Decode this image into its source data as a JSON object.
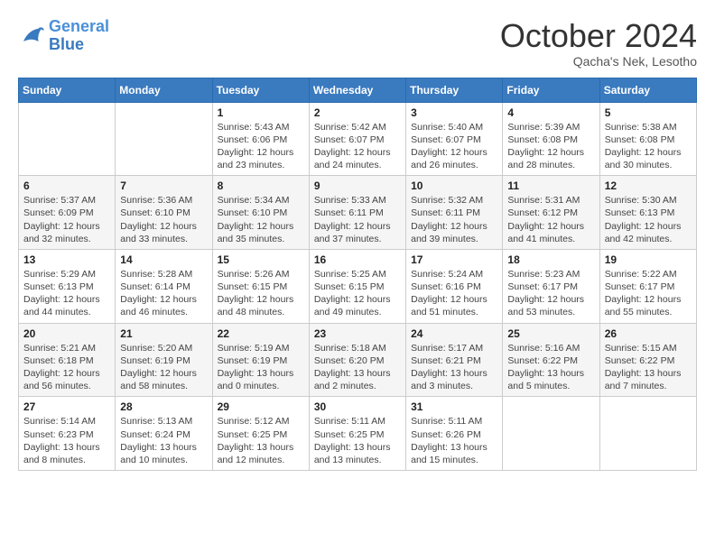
{
  "header": {
    "logo_line1": "General",
    "logo_line2": "Blue",
    "month": "October 2024",
    "location": "Qacha's Nek, Lesotho"
  },
  "weekdays": [
    "Sunday",
    "Monday",
    "Tuesday",
    "Wednesday",
    "Thursday",
    "Friday",
    "Saturday"
  ],
  "weeks": [
    [
      {
        "day": "",
        "detail": ""
      },
      {
        "day": "",
        "detail": ""
      },
      {
        "day": "1",
        "detail": "Sunrise: 5:43 AM\nSunset: 6:06 PM\nDaylight: 12 hours and 23 minutes."
      },
      {
        "day": "2",
        "detail": "Sunrise: 5:42 AM\nSunset: 6:07 PM\nDaylight: 12 hours and 24 minutes."
      },
      {
        "day": "3",
        "detail": "Sunrise: 5:40 AM\nSunset: 6:07 PM\nDaylight: 12 hours and 26 minutes."
      },
      {
        "day": "4",
        "detail": "Sunrise: 5:39 AM\nSunset: 6:08 PM\nDaylight: 12 hours and 28 minutes."
      },
      {
        "day": "5",
        "detail": "Sunrise: 5:38 AM\nSunset: 6:08 PM\nDaylight: 12 hours and 30 minutes."
      }
    ],
    [
      {
        "day": "6",
        "detail": "Sunrise: 5:37 AM\nSunset: 6:09 PM\nDaylight: 12 hours and 32 minutes."
      },
      {
        "day": "7",
        "detail": "Sunrise: 5:36 AM\nSunset: 6:10 PM\nDaylight: 12 hours and 33 minutes."
      },
      {
        "day": "8",
        "detail": "Sunrise: 5:34 AM\nSunset: 6:10 PM\nDaylight: 12 hours and 35 minutes."
      },
      {
        "day": "9",
        "detail": "Sunrise: 5:33 AM\nSunset: 6:11 PM\nDaylight: 12 hours and 37 minutes."
      },
      {
        "day": "10",
        "detail": "Sunrise: 5:32 AM\nSunset: 6:11 PM\nDaylight: 12 hours and 39 minutes."
      },
      {
        "day": "11",
        "detail": "Sunrise: 5:31 AM\nSunset: 6:12 PM\nDaylight: 12 hours and 41 minutes."
      },
      {
        "day": "12",
        "detail": "Sunrise: 5:30 AM\nSunset: 6:13 PM\nDaylight: 12 hours and 42 minutes."
      }
    ],
    [
      {
        "day": "13",
        "detail": "Sunrise: 5:29 AM\nSunset: 6:13 PM\nDaylight: 12 hours and 44 minutes."
      },
      {
        "day": "14",
        "detail": "Sunrise: 5:28 AM\nSunset: 6:14 PM\nDaylight: 12 hours and 46 minutes."
      },
      {
        "day": "15",
        "detail": "Sunrise: 5:26 AM\nSunset: 6:15 PM\nDaylight: 12 hours and 48 minutes."
      },
      {
        "day": "16",
        "detail": "Sunrise: 5:25 AM\nSunset: 6:15 PM\nDaylight: 12 hours and 49 minutes."
      },
      {
        "day": "17",
        "detail": "Sunrise: 5:24 AM\nSunset: 6:16 PM\nDaylight: 12 hours and 51 minutes."
      },
      {
        "day": "18",
        "detail": "Sunrise: 5:23 AM\nSunset: 6:17 PM\nDaylight: 12 hours and 53 minutes."
      },
      {
        "day": "19",
        "detail": "Sunrise: 5:22 AM\nSunset: 6:17 PM\nDaylight: 12 hours and 55 minutes."
      }
    ],
    [
      {
        "day": "20",
        "detail": "Sunrise: 5:21 AM\nSunset: 6:18 PM\nDaylight: 12 hours and 56 minutes."
      },
      {
        "day": "21",
        "detail": "Sunrise: 5:20 AM\nSunset: 6:19 PM\nDaylight: 12 hours and 58 minutes."
      },
      {
        "day": "22",
        "detail": "Sunrise: 5:19 AM\nSunset: 6:19 PM\nDaylight: 13 hours and 0 minutes."
      },
      {
        "day": "23",
        "detail": "Sunrise: 5:18 AM\nSunset: 6:20 PM\nDaylight: 13 hours and 2 minutes."
      },
      {
        "day": "24",
        "detail": "Sunrise: 5:17 AM\nSunset: 6:21 PM\nDaylight: 13 hours and 3 minutes."
      },
      {
        "day": "25",
        "detail": "Sunrise: 5:16 AM\nSunset: 6:22 PM\nDaylight: 13 hours and 5 minutes."
      },
      {
        "day": "26",
        "detail": "Sunrise: 5:15 AM\nSunset: 6:22 PM\nDaylight: 13 hours and 7 minutes."
      }
    ],
    [
      {
        "day": "27",
        "detail": "Sunrise: 5:14 AM\nSunset: 6:23 PM\nDaylight: 13 hours and 8 minutes."
      },
      {
        "day": "28",
        "detail": "Sunrise: 5:13 AM\nSunset: 6:24 PM\nDaylight: 13 hours and 10 minutes."
      },
      {
        "day": "29",
        "detail": "Sunrise: 5:12 AM\nSunset: 6:25 PM\nDaylight: 13 hours and 12 minutes."
      },
      {
        "day": "30",
        "detail": "Sunrise: 5:11 AM\nSunset: 6:25 PM\nDaylight: 13 hours and 13 minutes."
      },
      {
        "day": "31",
        "detail": "Sunrise: 5:11 AM\nSunset: 6:26 PM\nDaylight: 13 hours and 15 minutes."
      },
      {
        "day": "",
        "detail": ""
      },
      {
        "day": "",
        "detail": ""
      }
    ]
  ]
}
